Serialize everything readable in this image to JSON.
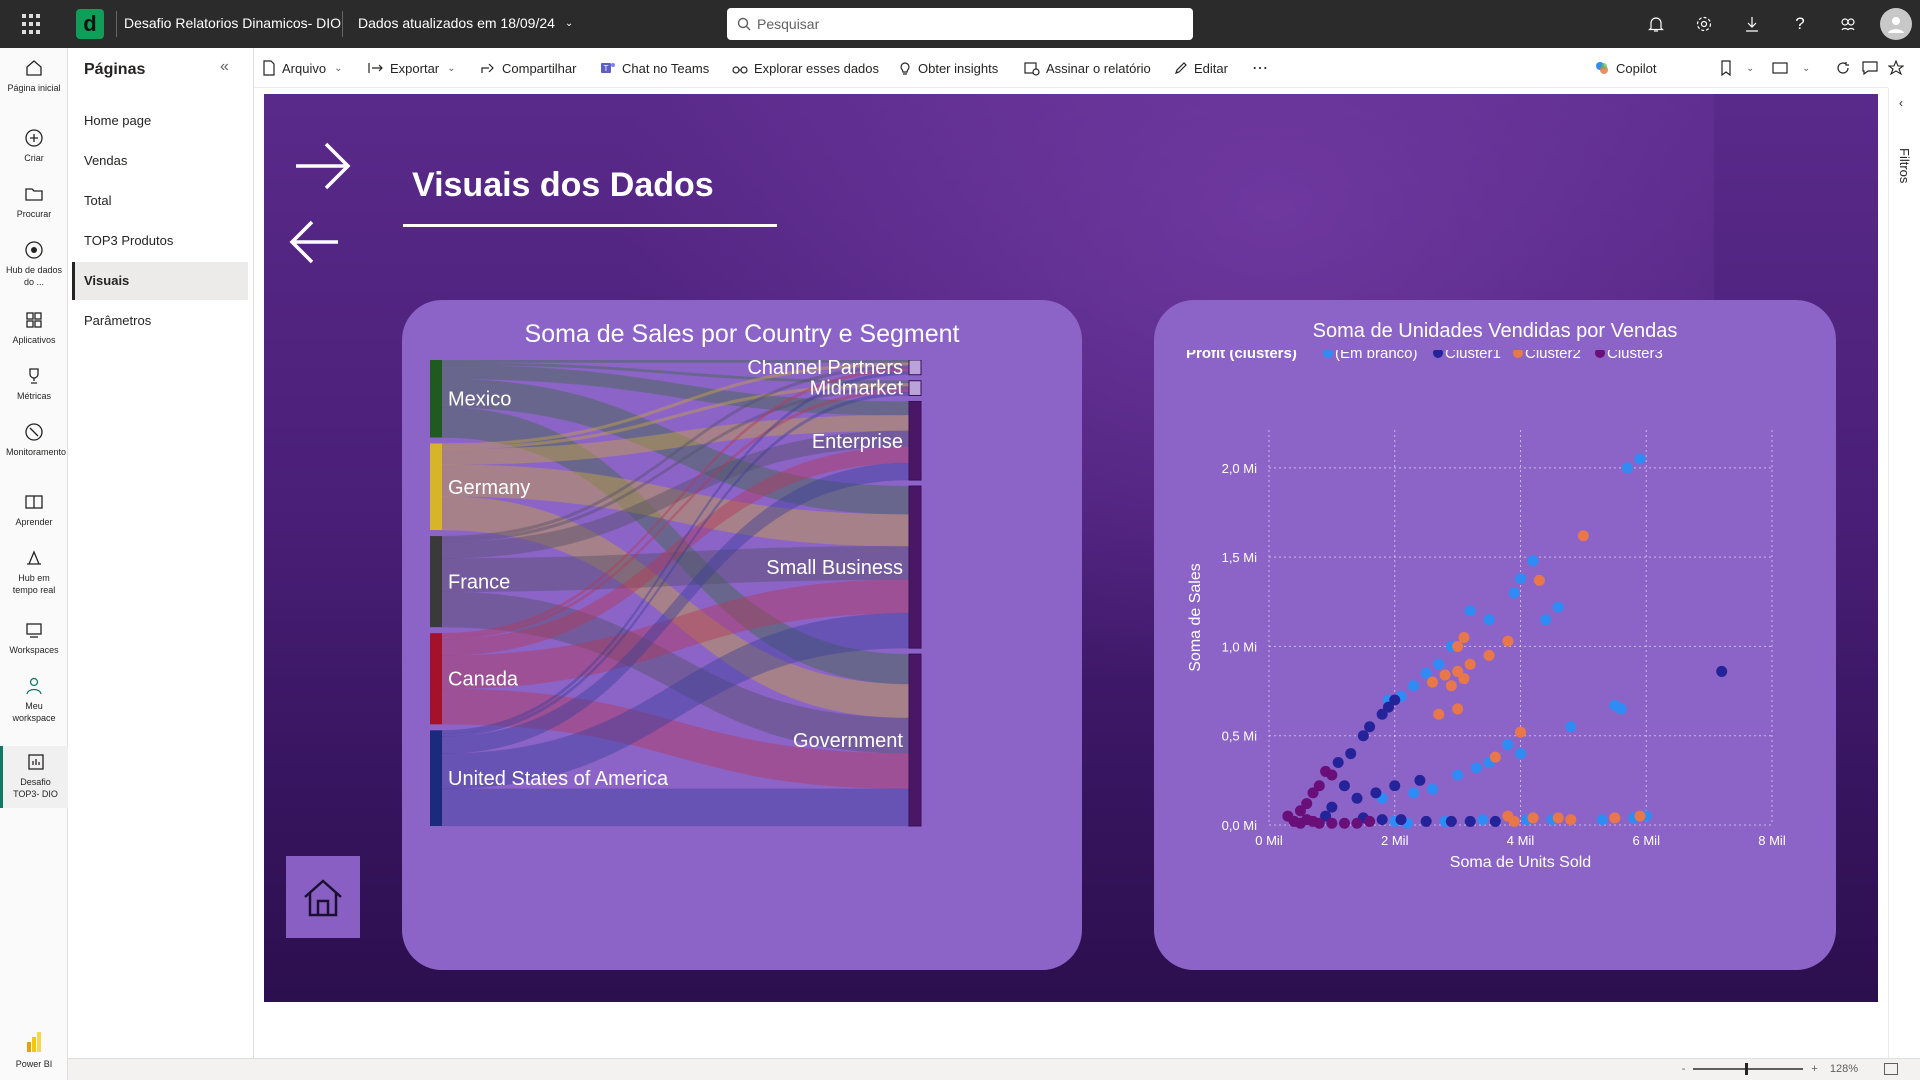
{
  "topbar": {
    "workspace_title": "Desafio Relatorios Dinamicos- DIO",
    "updated": "Dados atualizados em 18/09/24",
    "search_placeholder": "Pesquisar"
  },
  "leftnav": [
    {
      "label": "Página inicial",
      "icon": "home-icon"
    },
    {
      "label": "Criar",
      "icon": "create-icon"
    },
    {
      "label": "Procurar",
      "icon": "folder-icon"
    },
    {
      "label": "Hub de dados do ...",
      "icon": "data-hub-icon"
    },
    {
      "label": "Aplicativos",
      "icon": "apps-icon"
    },
    {
      "label": "Métricas",
      "icon": "trophy-icon"
    },
    {
      "label": "Monitoramento",
      "icon": "monitor-icon"
    },
    {
      "label": "Aprender",
      "icon": "book-icon"
    },
    {
      "label": "Hub em tempo real",
      "icon": "realtime-icon"
    },
    {
      "label": "Workspaces",
      "icon": "workspaces-icon"
    },
    {
      "label": "Meu workspace",
      "icon": "person-icon"
    },
    {
      "label": "Desafio TOP3- DIO",
      "icon": "report-icon"
    },
    {
      "label": "Power BI",
      "icon": "powerbi-icon"
    }
  ],
  "pages": {
    "title": "Páginas",
    "items": [
      "Home page",
      "Vendas",
      "Total",
      "TOP3 Produtos",
      "Visuais",
      "Parâmetros"
    ],
    "active": "Visuais"
  },
  "cmdbar": {
    "arquivo": "Arquivo",
    "exportar": "Exportar",
    "compartilhar": "Compartilhar",
    "chat": "Chat no Teams",
    "explorar": "Explorar esses dados",
    "insights": "Obter insights",
    "assinar": "Assinar o relatório",
    "editar": "Editar",
    "copilot": "Copilot"
  },
  "report": {
    "title": "Visuais dos Dados"
  },
  "filters_label": "Filtros",
  "status": {
    "zoom": "128%"
  },
  "colors": {
    "accent": "#117865",
    "report_bg": "#4a1f78",
    "card_bg": "#8c64c8",
    "em_branco": "#2f8cf5",
    "cluster1": "#24239a",
    "cluster2": "#e8784a",
    "cluster3": "#6a0f7a"
  },
  "chart_data": [
    {
      "type": "sankey",
      "title": "Soma de Sales por Country e Segment",
      "sources": [
        {
          "name": "Mexico",
          "color": "#1f5a1f"
        },
        {
          "name": "Germany",
          "color": "#d6b52b"
        },
        {
          "name": "France",
          "color": "#3a3a3a"
        },
        {
          "name": "Canada",
          "color": "#a3122a"
        },
        {
          "name": "United States of America",
          "color": "#1b2a7a"
        }
      ],
      "targets": [
        "Channel Partners",
        "Midmarket",
        "Enterprise",
        "Small Business",
        "Government"
      ],
      "source_share": [
        0.17,
        0.19,
        0.2,
        0.2,
        0.21
      ],
      "target_share": [
        0.03,
        0.03,
        0.16,
        0.33,
        0.35
      ]
    },
    {
      "type": "scatter",
      "title": "Soma de Unidades Vendidas por Vendas",
      "legend_title": "Profit (clusters)",
      "legend": [
        "(Em branco)",
        "Cluster1",
        "Cluster2",
        "Cluster3"
      ],
      "xlabel": "Soma de Units Sold",
      "ylabel": "Soma de Sales",
      "x_ticks": [
        "0 Mil",
        "2 Mil",
        "4 Mil",
        "6 Mil",
        "8 Mil"
      ],
      "y_ticks": [
        "0,0 Mi",
        "0,5 Mi",
        "1,0 Mi",
        "1,5 Mi",
        "2,0 Mi"
      ],
      "xlim": [
        0,
        8
      ],
      "ylim": [
        0,
        2.1
      ],
      "series": [
        {
          "name": "(Em branco)",
          "color": "#2f8cf5",
          "points": [
            [
              1.9,
              0.7
            ],
            [
              2.1,
              0.72
            ],
            [
              2.3,
              0.78
            ],
            [
              2.5,
              0.85
            ],
            [
              2.7,
              0.9
            ],
            [
              2.9,
              1.0
            ],
            [
              3.2,
              1.2
            ],
            [
              3.5,
              1.15
            ],
            [
              3.9,
              1.3
            ],
            [
              4.0,
              1.38
            ],
            [
              4.2,
              1.48
            ],
            [
              4.4,
              1.15
            ],
            [
              4.6,
              1.22
            ],
            [
              5.7,
              2.0
            ],
            [
              5.9,
              2.05
            ],
            [
              5.5,
              0.67
            ],
            [
              5.6,
              0.65
            ],
            [
              4.8,
              0.55
            ],
            [
              4.0,
              0.4
            ],
            [
              3.5,
              0.35
            ],
            [
              3.0,
              0.28
            ],
            [
              2.6,
              0.2
            ],
            [
              2.3,
              0.18
            ],
            [
              1.8,
              0.15
            ],
            [
              3.8,
              0.45
            ],
            [
              3.3,
              0.32
            ],
            [
              5.8,
              0.04
            ],
            [
              5.3,
              0.03
            ],
            [
              4.5,
              0.03
            ],
            [
              2.8,
              0.02
            ],
            [
              3.4,
              0.03
            ],
            [
              4.1,
              0.03
            ],
            [
              6.0,
              0.05
            ],
            [
              2.2,
              0.01
            ],
            [
              2.0,
              0.02
            ],
            [
              1.4,
              0.01
            ]
          ]
        },
        {
          "name": "Cluster1",
          "color": "#24239a",
          "points": [
            [
              1.1,
              0.35
            ],
            [
              1.3,
              0.4
            ],
            [
              1.5,
              0.5
            ],
            [
              1.6,
              0.55
            ],
            [
              1.8,
              0.62
            ],
            [
              1.9,
              0.66
            ],
            [
              2.0,
              0.7
            ],
            [
              1.2,
              0.22
            ],
            [
              1.4,
              0.15
            ],
            [
              1.7,
              0.18
            ],
            [
              2.0,
              0.22
            ],
            [
              2.4,
              0.25
            ],
            [
              1.5,
              0.04
            ],
            [
              1.8,
              0.03
            ],
            [
              2.1,
              0.03
            ],
            [
              2.5,
              0.02
            ],
            [
              2.9,
              0.02
            ],
            [
              3.2,
              0.02
            ],
            [
              7.2,
              0.86
            ],
            [
              1.0,
              0.1
            ],
            [
              0.9,
              0.05
            ],
            [
              3.6,
              0.02
            ]
          ]
        },
        {
          "name": "Cluster2",
          "color": "#e8784a",
          "points": [
            [
              2.6,
              0.8
            ],
            [
              2.8,
              0.84
            ],
            [
              3.0,
              0.86
            ],
            [
              3.2,
              0.9
            ],
            [
              2.9,
              0.78
            ],
            [
              3.1,
              0.82
            ],
            [
              3.0,
              1.0
            ],
            [
              3.1,
              1.05
            ],
            [
              3.5,
              0.95
            ],
            [
              3.8,
              1.03
            ],
            [
              4.3,
              1.37
            ],
            [
              5.0,
              1.62
            ],
            [
              2.7,
              0.62
            ],
            [
              3.0,
              0.65
            ],
            [
              4.0,
              0.52
            ],
            [
              3.6,
              0.38
            ],
            [
              3.8,
              0.05
            ],
            [
              4.2,
              0.04
            ],
            [
              4.8,
              0.03
            ],
            [
              5.5,
              0.04
            ],
            [
              5.9,
              0.05
            ],
            [
              3.9,
              0.02
            ],
            [
              4.6,
              0.04
            ]
          ]
        },
        {
          "name": "Cluster3",
          "color": "#6a0f7a",
          "points": [
            [
              0.3,
              0.05
            ],
            [
              0.4,
              0.02
            ],
            [
              0.5,
              0.08
            ],
            [
              0.6,
              0.12
            ],
            [
              0.7,
              0.18
            ],
            [
              0.8,
              0.22
            ],
            [
              0.9,
              0.3
            ],
            [
              1.0,
              0.28
            ],
            [
              0.6,
              0.03
            ],
            [
              0.8,
              0.01
            ],
            [
              1.0,
              0.01
            ],
            [
              1.2,
              0.01
            ],
            [
              1.4,
              0.01
            ],
            [
              1.6,
              0.02
            ],
            [
              0.5,
              0.01
            ],
            [
              0.7,
              0.02
            ]
          ]
        }
      ]
    }
  ]
}
